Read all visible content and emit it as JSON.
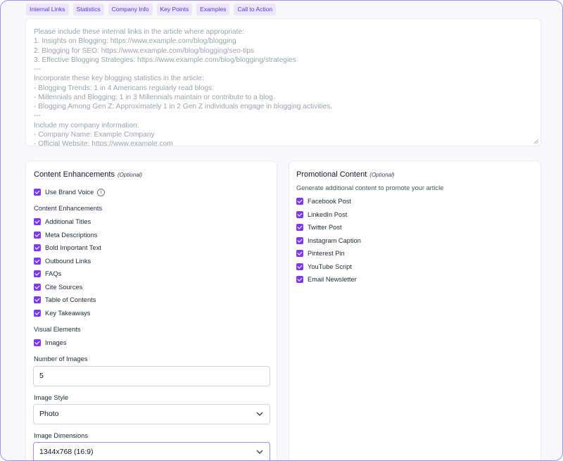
{
  "tags": [
    "Internal Links",
    "Statistics",
    "Company Info",
    "Key Points",
    "Examples",
    "Call to Action"
  ],
  "prompt": {
    "lines": [
      "Please include these internal links in the article where appropriate:",
      "1. Insights on Blogging: https://www.example.com/blog/blogging",
      "2. Blogging for SEO: https://www.example.com/blog/blogging/seo-tips",
      "3. Effective Blogging Strategies: https://www.example.com/blog/blogging/strategies",
      "---",
      "Incorporate these key blogging statistics in the article:",
      "- Blogging Trends: 1 in 4 Americans regularly read blogs.",
      "- Millennials and Blogging: 1 in 3 Millennials maintain or contribute to a blog.",
      "- Blogging Among Gen Z: Approximately 1 in 2 Gen Z individuals engage in blogging activities.",
      "---",
      "Include my company information:",
      "- Company Name: Example Company",
      "- Official Website: https://www.example.com"
    ]
  },
  "content_enhancements": {
    "title": "Content Enhancements",
    "optional": "(Optional)",
    "brand_voice": {
      "label": "Use Brand Voice",
      "checked": true,
      "info_icon": "info-circle-icon"
    },
    "enhancements_label": "Content Enhancements",
    "items": [
      {
        "label": "Additional Titles",
        "checked": true
      },
      {
        "label": "Meta Descriptions",
        "checked": true
      },
      {
        "label": "Bold Important Text",
        "checked": true
      },
      {
        "label": "Outbound Links",
        "checked": true
      },
      {
        "label": "FAQs",
        "checked": true
      },
      {
        "label": "Cite Sources",
        "checked": true
      },
      {
        "label": "Table of Contents",
        "checked": true
      },
      {
        "label": "Key Takeaways",
        "checked": true
      }
    ],
    "visual_label": "Visual Elements",
    "images": {
      "label": "Images",
      "checked": true
    },
    "num_images": {
      "label": "Number of Images",
      "value": "5"
    },
    "image_style": {
      "label": "Image Style",
      "value": "Photo"
    },
    "image_dimensions": {
      "label": "Image Dimensions",
      "value": "1344x768 (16:9)"
    }
  },
  "promotional": {
    "title": "Promotional Content",
    "optional": "(Optional)",
    "description": "Generate additional content to promote your article",
    "items": [
      {
        "label": "Facebook Post",
        "checked": true
      },
      {
        "label": "LinkedIn Post",
        "checked": true
      },
      {
        "label": "Twitter Post",
        "checked": true
      },
      {
        "label": "Instagram Caption",
        "checked": true
      },
      {
        "label": "Pinterest Pin",
        "checked": true
      },
      {
        "label": "YouTube Script",
        "checked": true
      },
      {
        "label": "Email Newsletter",
        "checked": true
      }
    ]
  },
  "colors": {
    "accent": "#7c3aed",
    "tag_bg": "#ece6fd",
    "tag_text": "#5b34d6",
    "frame_border": "#a98ff0"
  }
}
